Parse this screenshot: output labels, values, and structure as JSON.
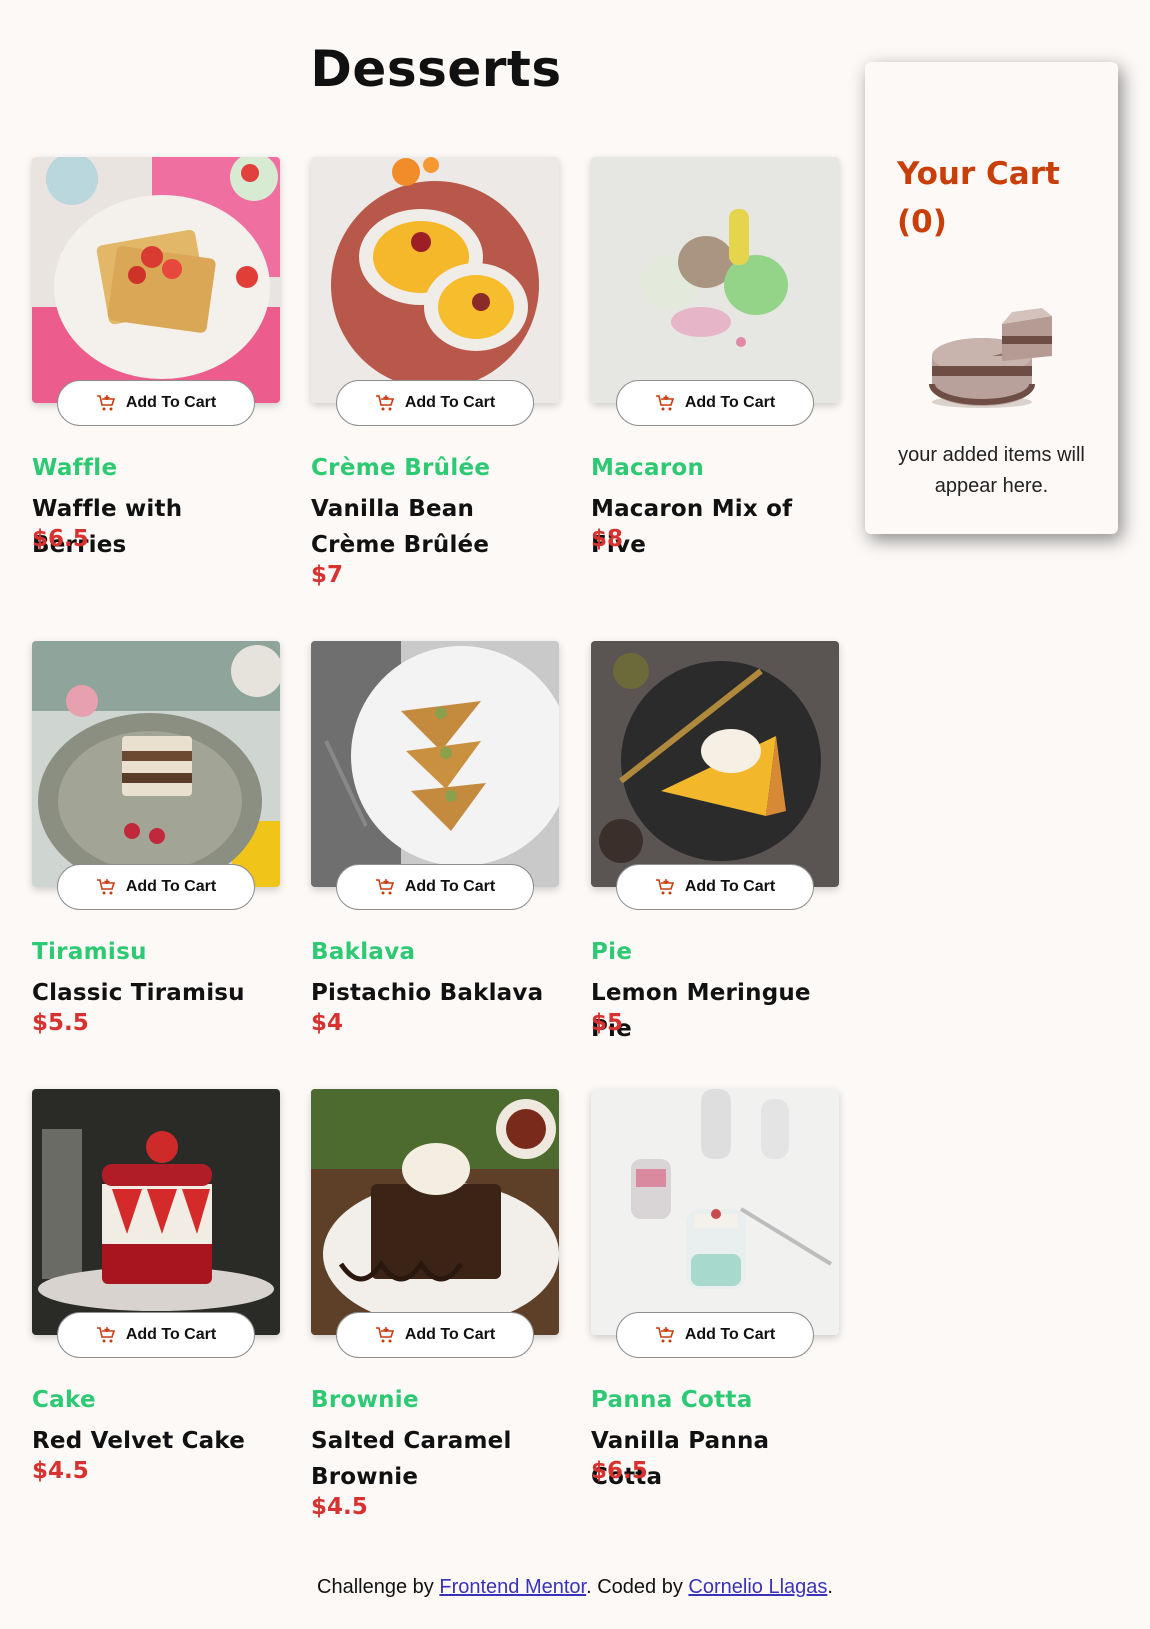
{
  "page": {
    "title": "Desserts"
  },
  "products": [
    {
      "category": "Waffle",
      "name": "Waffle with Berries",
      "price": "$6.5",
      "button": "Add To Cart"
    },
    {
      "category": "Crème Brûlée",
      "name": "Vanilla Bean Crème Brûlée",
      "price": "$7",
      "button": "Add To Cart"
    },
    {
      "category": "Macaron",
      "name": "Macaron Mix of Five",
      "price": "$8",
      "button": "Add To Cart"
    },
    {
      "category": "Tiramisu",
      "name": "Classic Tiramisu",
      "price": "$5.5",
      "button": "Add To Cart"
    },
    {
      "category": "Baklava",
      "name": "Pistachio Baklava",
      "price": "$4",
      "button": "Add To Cart"
    },
    {
      "category": "Pie",
      "name": "Lemon Meringue Pie",
      "price": "$5",
      "button": "Add To Cart"
    },
    {
      "category": "Cake",
      "name": "Red Velvet Cake",
      "price": "$4.5",
      "button": "Add To Cart"
    },
    {
      "category": "Brownie",
      "name": "Salted Caramel Brownie",
      "price": "$4.5",
      "button": "Add To Cart"
    },
    {
      "category": "Panna Cotta",
      "name": "Vanilla Panna Cotta",
      "price": "$6.5",
      "button": "Add To Cart"
    }
  ],
  "cart": {
    "title": "Your Cart",
    "count": "(0)",
    "empty_message": "your added items will appear here."
  },
  "footer": {
    "prefix": "Challenge by ",
    "link1": "Frontend Mentor",
    "middle": ". Coded by ",
    "link2": "Cornelio Llagas",
    "suffix": "."
  },
  "colors": {
    "background": "#fcf9f7",
    "category": "#2ec973",
    "price": "#d7322f",
    "cart_title": "#c83f0a",
    "link": "#3a32b8"
  }
}
